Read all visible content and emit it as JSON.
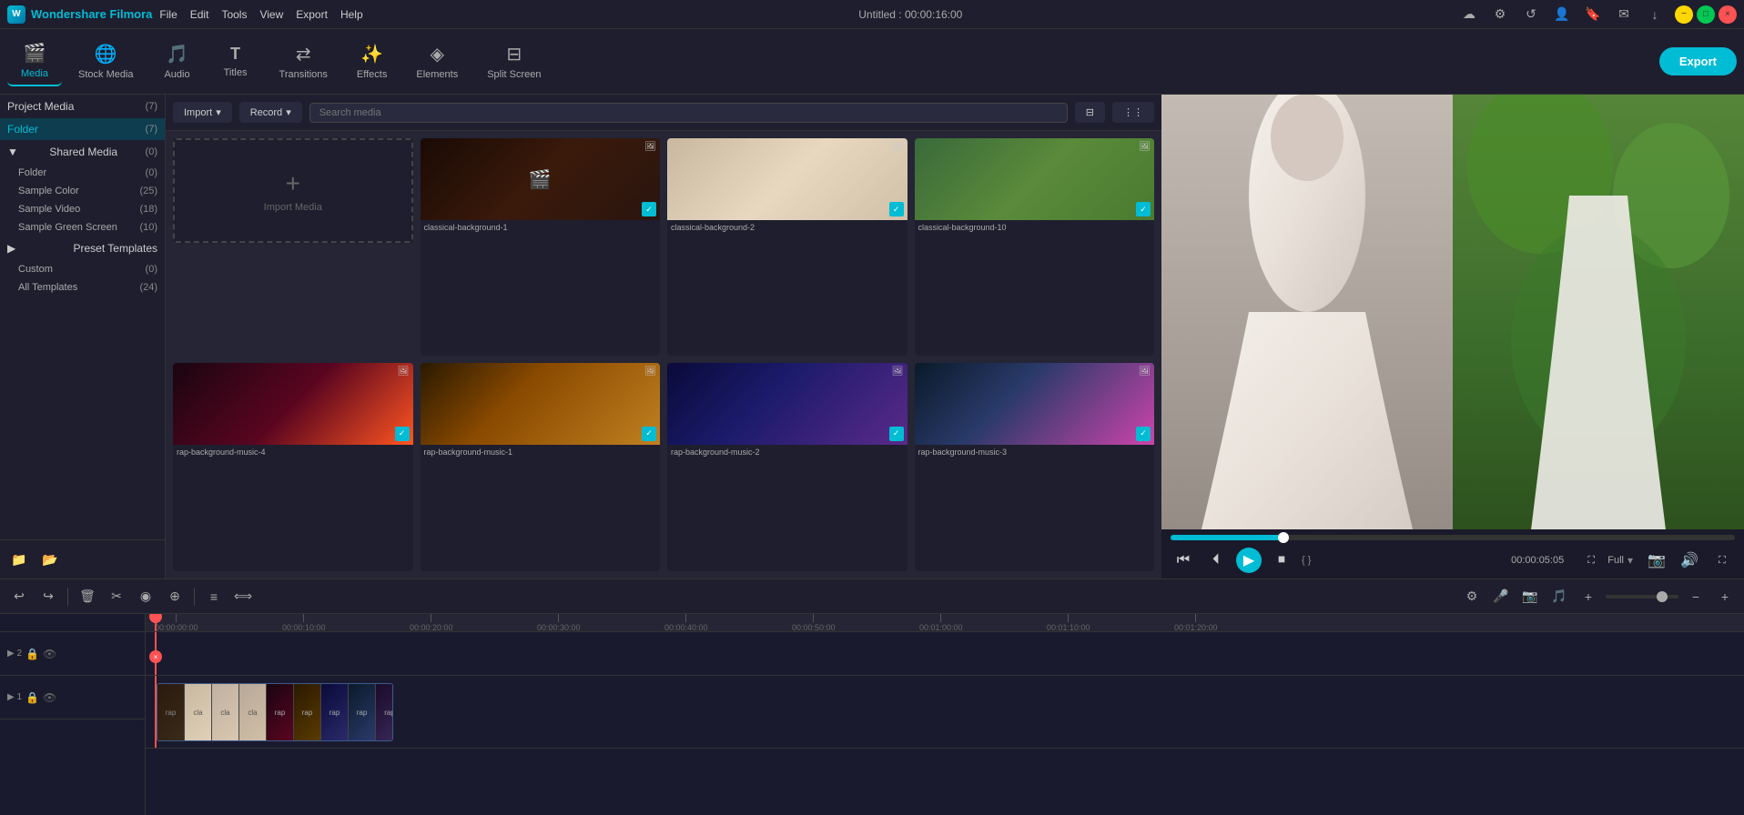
{
  "app": {
    "name": "Wondershare Filmora",
    "title": "Untitled : 00:00:16:00"
  },
  "menu": {
    "items": [
      "File",
      "Edit",
      "Tools",
      "View",
      "Export",
      "Help"
    ]
  },
  "toolbar": {
    "items": [
      {
        "id": "media",
        "label": "Media",
        "icon": "🎬",
        "active": true
      },
      {
        "id": "stock-media",
        "label": "Stock Media",
        "icon": "🌐",
        "active": false
      },
      {
        "id": "audio",
        "label": "Audio",
        "icon": "🎵",
        "active": false
      },
      {
        "id": "titles",
        "label": "Titles",
        "icon": "T",
        "active": false
      },
      {
        "id": "transitions",
        "label": "Transitions",
        "icon": "⇄",
        "active": false
      },
      {
        "id": "effects",
        "label": "Effects",
        "icon": "✨",
        "active": false
      },
      {
        "id": "elements",
        "label": "Elements",
        "icon": "◈",
        "active": false
      },
      {
        "id": "split-screen",
        "label": "Split Screen",
        "icon": "⊟",
        "active": false
      }
    ],
    "export_label": "Export"
  },
  "left_panel": {
    "project_media": {
      "label": "Project Media",
      "count": "(7)",
      "folder": {
        "label": "Folder",
        "count": "(7)"
      }
    },
    "shared_media": {
      "label": "Shared Media",
      "count": "(0)",
      "folder": {
        "label": "Folder",
        "count": "(0)"
      },
      "items": [
        {
          "label": "Sample Color",
          "count": "(25)"
        },
        {
          "label": "Sample Video",
          "count": "(18)"
        },
        {
          "label": "Sample Green Screen",
          "count": "(10)"
        }
      ]
    },
    "preset_templates": {
      "label": "Preset Templates",
      "items": [
        {
          "label": "Custom",
          "count": "(0)"
        },
        {
          "label": "All Templates",
          "count": "(24)"
        }
      ]
    }
  },
  "media_toolbar": {
    "import_label": "Import",
    "record_label": "Record",
    "search_placeholder": "Search media"
  },
  "media_items": [
    {
      "id": "import",
      "type": "import",
      "label": "Import Media"
    },
    {
      "id": "classical-1",
      "label": "classical-background-1",
      "checked": true
    },
    {
      "id": "classical-2",
      "label": "classical-background-2",
      "checked": true
    },
    {
      "id": "classical-10",
      "label": "classical-background-10",
      "checked": true
    },
    {
      "id": "rap-4",
      "label": "rap-background-music-4",
      "checked": true
    },
    {
      "id": "rap-1",
      "label": "rap-background-music-1",
      "checked": true
    },
    {
      "id": "rap-2",
      "label": "rap-background-music-2",
      "checked": true
    },
    {
      "id": "rap-3",
      "label": "rap-background-music-3",
      "checked": true
    }
  ],
  "preview": {
    "progress_percent": 20,
    "current_time": "00:00:05:05",
    "zoom_level": "Full",
    "markers": "{  }"
  },
  "timeline": {
    "current_time": "00:00:00:00",
    "marks": [
      "00:00:00:00",
      "00:00:10:00",
      "00:00:20:00",
      "00:00:30:00",
      "00:00:40:00",
      "00:00:50:00",
      "00:01:00:00",
      "00:01:10:00",
      "00:01:20:00"
    ],
    "tracks": [
      {
        "id": "track2",
        "label": "2"
      },
      {
        "id": "track1",
        "label": "1"
      }
    ],
    "clip_labels": [
      "rap",
      "cla",
      "cla",
      "cla",
      "rap",
      "rap",
      "rap",
      "rap",
      "rap"
    ]
  },
  "colors": {
    "accent": "#00bcd4",
    "bg_dark": "#1a1a2e",
    "bg_medium": "#1e1e2e",
    "playhead": "#ff5252"
  }
}
